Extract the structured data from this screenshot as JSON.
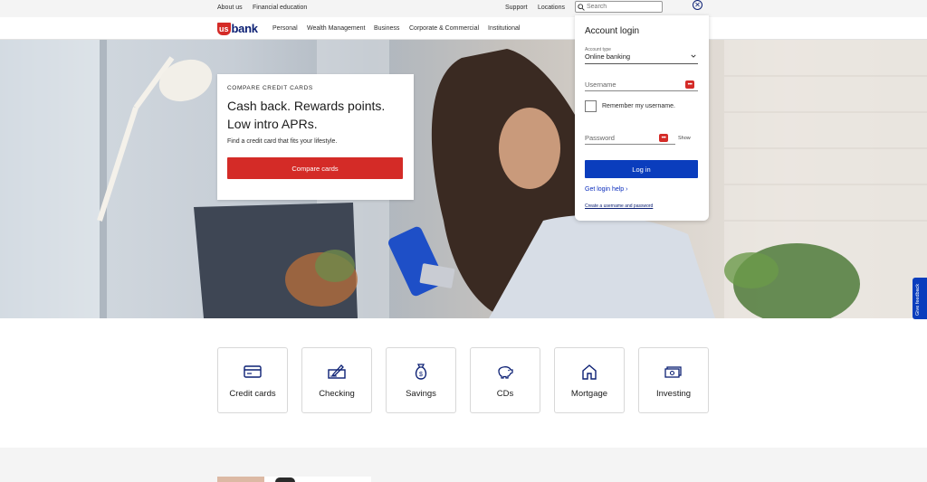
{
  "topbar": {
    "links": [
      "About us",
      "Financial education",
      "Support",
      "Locations"
    ],
    "search_placeholder": "Search",
    "close_glyph": "✕"
  },
  "nav": {
    "logo_us": "us",
    "logo_bank": "bank",
    "items": [
      "Personal",
      "Wealth Management",
      "Business",
      "Corporate & Commercial",
      "Institutional"
    ]
  },
  "promo": {
    "eyebrow": "COMPARE CREDIT CARDS",
    "headline": "Cash back. Rewards points. Low intro APRs.",
    "subtext": "Find a credit card that fits your lifestyle.",
    "cta": "Compare cards"
  },
  "login": {
    "title": "Account login",
    "account_type_label": "Account type",
    "account_type_value": "Online banking",
    "username_placeholder": "Username",
    "remember_label": "Remember my username.",
    "password_placeholder": "Password",
    "show_label": "Show",
    "login_button": "Log in",
    "help_link": "Get login help ›",
    "create_link": "Create a username and password"
  },
  "feedback": {
    "label": "Give feedback"
  },
  "products": [
    {
      "label": "Credit cards",
      "icon": "credit-card-icon"
    },
    {
      "label": "Checking",
      "icon": "checkbook-icon"
    },
    {
      "label": "Savings",
      "icon": "money-bag-icon"
    },
    {
      "label": "CDs",
      "icon": "piggy-bank-icon"
    },
    {
      "label": "Mortgage",
      "icon": "house-icon"
    },
    {
      "label": "Investing",
      "icon": "cash-stack-icon"
    }
  ],
  "colors": {
    "brand_red": "#d42b27",
    "brand_navy": "#0c2074",
    "button_blue": "#0a3dbd"
  }
}
